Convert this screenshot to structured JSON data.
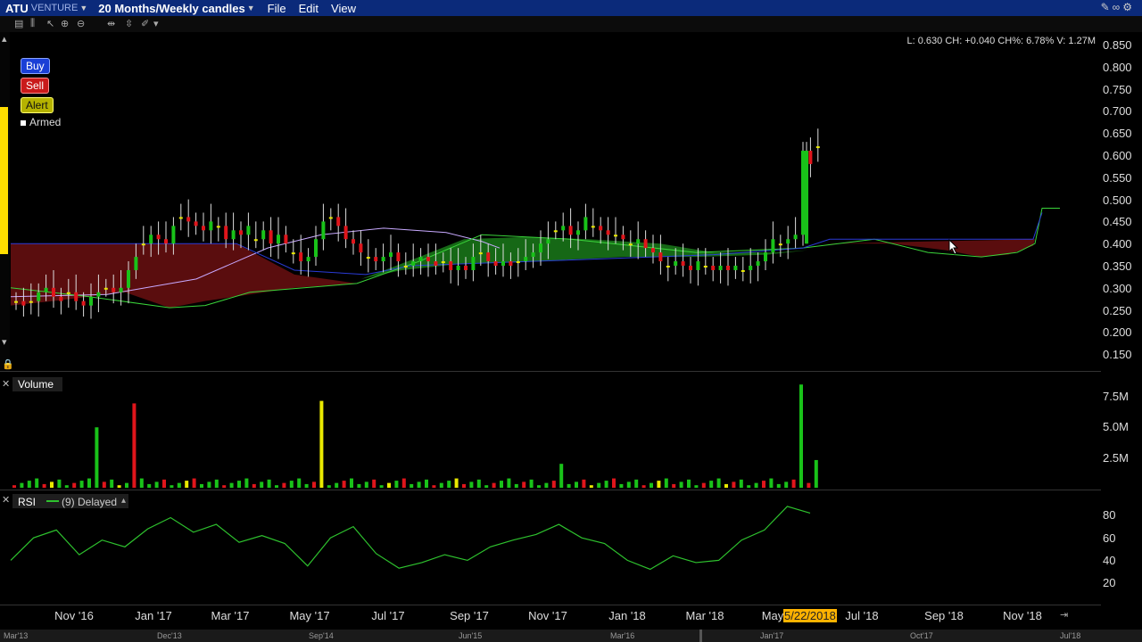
{
  "header": {
    "symbol": "ATU",
    "exchange": "VENTURE",
    "period": "20 Months/Weekly candles",
    "menus": [
      "File",
      "Edit",
      "View"
    ]
  },
  "order_buttons": {
    "buy": "Buy",
    "sell": "Sell",
    "alert": "Alert",
    "armed": "Armed"
  },
  "quote_line": "L: 0.630 CH: +0.040 CH%: 6.78% V: 1.27M",
  "volume_panel": {
    "title": "Volume",
    "ticks": [
      "7.5M",
      "5.0M",
      "2.5M"
    ]
  },
  "rsi_panel": {
    "title": "RSI",
    "legend": "(9) Delayed",
    "ticks": [
      "80",
      "60",
      "40",
      "20"
    ]
  },
  "price_ticks": [
    "0.850",
    "0.800",
    "0.750",
    "0.700",
    "0.650",
    "0.600",
    "0.550",
    "0.500",
    "0.450",
    "0.400",
    "0.350",
    "0.300",
    "0.250",
    "0.200",
    "0.150"
  ],
  "x_axis": {
    "labels": [
      "Nov '16",
      "Jan '17",
      "Mar '17",
      "May '17",
      "Jul '17",
      "Sep '17",
      "Nov '17",
      "Jan '18",
      "Mar '18",
      "May",
      "Jul '18",
      "Sep '18",
      "Nov '18"
    ],
    "highlight": "5/22/2018"
  },
  "overview_strip": [
    "Mar'13",
    "Dec'13",
    "Sep'14",
    "Jun'15",
    "Mar'16",
    "Jan'17",
    "Oct'17",
    "Jul'18"
  ],
  "colors": {
    "up": "#19c219",
    "down": "#e0151b",
    "doji": "#e8e800",
    "cloud_bull": "#1a7a1a",
    "cloud_bear": "#6a0f10",
    "rsi": "#2ec22e",
    "menubar": "#0b2a7a"
  },
  "chart_data": [
    {
      "type": "candlestick",
      "title": "ATU 20 Months/Weekly candles",
      "ylim": [
        0.15,
        0.85
      ],
      "x": [
        "Nov '16",
        "Jan '17",
        "Mar '17",
        "May '17",
        "Jul '17",
        "Sep '17",
        "Nov '17",
        "Jan '18",
        "Mar '18",
        "May '18",
        "Jul '18",
        "Sep '18",
        "Nov '18"
      ],
      "series": [
        {
          "name": "weekly_close_approx",
          "values": [
            0.27,
            0.38,
            0.44,
            0.46,
            0.36,
            0.34,
            0.42,
            0.4,
            0.34,
            0.61,
            0.63,
            null,
            null
          ]
        }
      ]
    },
    {
      "type": "bar",
      "title": "Volume",
      "ylim": [
        0,
        8500000
      ],
      "peak_values": [
        {
          "x": "Dec '16",
          "value": 4800000
        },
        {
          "x": "Jan '17",
          "value": 6700000
        },
        {
          "x": "May '17",
          "value": 6900000
        },
        {
          "x": "May '18",
          "value": 8200000
        },
        {
          "x": "Jun '18",
          "value": 2200000
        }
      ]
    },
    {
      "type": "line",
      "title": "RSI",
      "ylim": [
        10,
        90
      ],
      "series": [
        {
          "name": "RSI (9)",
          "values": [
            40,
            60,
            67,
            45,
            58,
            52,
            68,
            78,
            65,
            72,
            56,
            62,
            55,
            35,
            60,
            70,
            46,
            33,
            38,
            45,
            40,
            52,
            58,
            63,
            72,
            60,
            55,
            40,
            32,
            44,
            38,
            40,
            58,
            67,
            88,
            82
          ]
        }
      ]
    }
  ]
}
